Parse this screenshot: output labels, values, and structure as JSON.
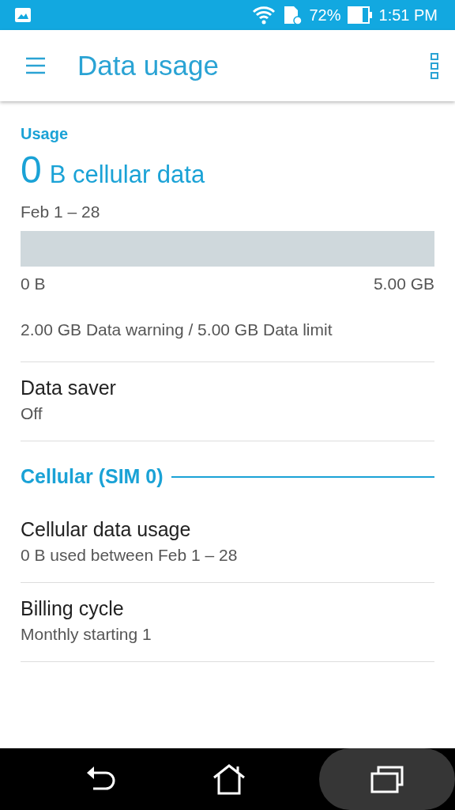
{
  "status_bar": {
    "battery": "72%",
    "time": "1:51 PM"
  },
  "app_bar": {
    "title": "Data usage"
  },
  "usage": {
    "header": "Usage",
    "amount": "0",
    "unit": "B cellular data",
    "period": "Feb 1 – 28",
    "bar": {
      "level": 0
    },
    "min_label": "0 B",
    "max_label": "5.00 GB",
    "summary": "2.00 GB Data warning / 5.00 GB Data limit"
  },
  "sections": [
    {
      "items": [
        {
          "title": "Data saver",
          "summary": "Off"
        }
      ]
    },
    {
      "header": "Cellular (SIM 0)",
      "items": [
        {
          "title": "Cellular data usage",
          "summary": "0 B used between Feb 1 – 28"
        },
        {
          "title": "Billing cycle",
          "summary": "Monthly starting 1"
        }
      ]
    }
  ],
  "nav_bar": [
    {
      "kind": "back",
      "selected": false
    },
    {
      "kind": "home",
      "selected": false
    },
    {
      "kind": "recents",
      "selected": true
    }
  ]
}
